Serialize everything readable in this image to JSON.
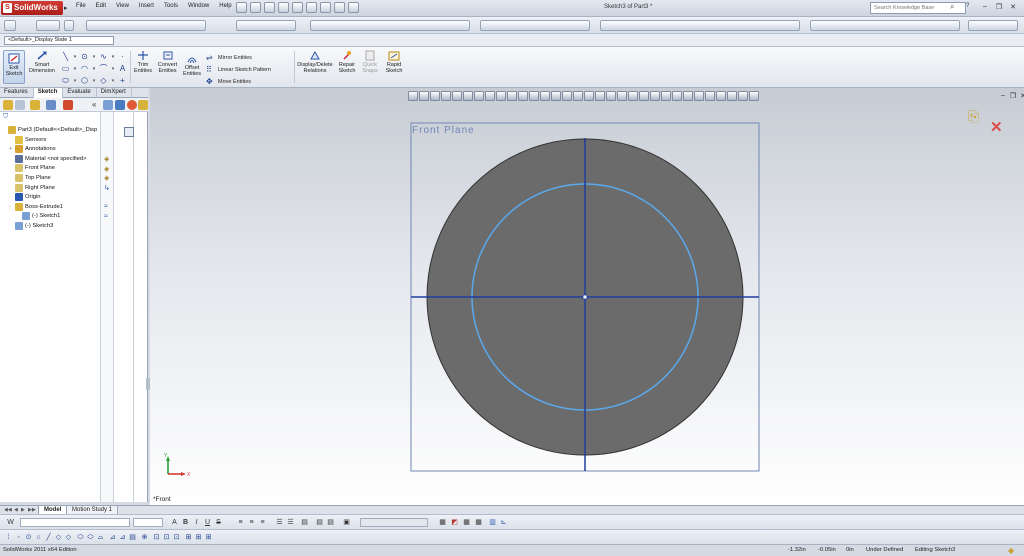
{
  "app": {
    "name": "SolidWorks",
    "menus": [
      "File",
      "Edit",
      "View",
      "Insert",
      "Tools",
      "Window",
      "Help"
    ],
    "document_title": "Sketch3 of Part3 *",
    "search_placeholder": "Search Knowledge Base",
    "help_glyph": "?"
  },
  "config": {
    "current": "<Default>_Display State 1"
  },
  "command_manager": {
    "exit_sketch": "Exit Sketch",
    "smart_dimension": "Smart Dimension",
    "trim_entities": "Trim Entities",
    "convert_entities": "Convert Entities",
    "offset_entities": "Offset Entities",
    "mirror_entities": "Mirror Entities",
    "linear_sketch_pattern": "Linear Sketch Pattern",
    "move_entities": "Move Entities",
    "display_delete_relations": "Display/Delete Relations",
    "repair_sketch": "Repair Sketch",
    "quick_snaps": "Quick Snaps",
    "rapid_sketch": "Rapid Sketch"
  },
  "panel": {
    "tabs": [
      "Features",
      "Sketch",
      "Evaluate",
      "DimXpert"
    ],
    "active_tab": "Sketch",
    "tree": [
      {
        "label": "Part3  (Default<<Default>_Disp",
        "icon": "part-icon",
        "expander": "",
        "indent": 0
      },
      {
        "label": "Sensors",
        "icon": "sensors-icon",
        "expander": "",
        "indent": 1
      },
      {
        "label": "Annotations",
        "icon": "annotations-icon",
        "expander": "+",
        "indent": 1
      },
      {
        "label": "Material <not specified>",
        "icon": "material-icon",
        "expander": "",
        "indent": 1
      },
      {
        "label": "Front Plane",
        "icon": "plane-icon",
        "expander": "",
        "indent": 1
      },
      {
        "label": "Top Plane",
        "icon": "plane-icon",
        "expander": "",
        "indent": 1
      },
      {
        "label": "Right Plane",
        "icon": "plane-icon",
        "expander": "",
        "indent": 1
      },
      {
        "label": "Origin",
        "icon": "origin-icon",
        "expander": "",
        "indent": 1
      },
      {
        "label": "Boss-Extrude1",
        "icon": "extrude-icon",
        "expander": "-",
        "indent": 1
      },
      {
        "label": "(-) Sketch1",
        "icon": "sketch-icon",
        "expander": "",
        "indent": 2
      },
      {
        "label": "(-) Sketch3",
        "icon": "sketch-icon",
        "expander": "",
        "indent": 1
      }
    ]
  },
  "graphics": {
    "plane_label": "Front Plane",
    "view_name": "*Front",
    "triad_y": "Y",
    "triad_x": "X"
  },
  "bottom_tabs": [
    "Model",
    "Motion Study 1"
  ],
  "active_bottom_tab": "Model",
  "status": {
    "edition": "SolidWorks 2011 x64 Edition",
    "x": "-1.32in",
    "y": "-0.05in",
    "z": "0in",
    "sketch_state": "Under Defined",
    "editing": "Editing Sketch3"
  },
  "colors": {
    "part_fill": "#6b6b6b",
    "sketch_circle": "#5aa9ee",
    "centerline": "#1f3d9e",
    "plane_border": "#6f86b5"
  }
}
